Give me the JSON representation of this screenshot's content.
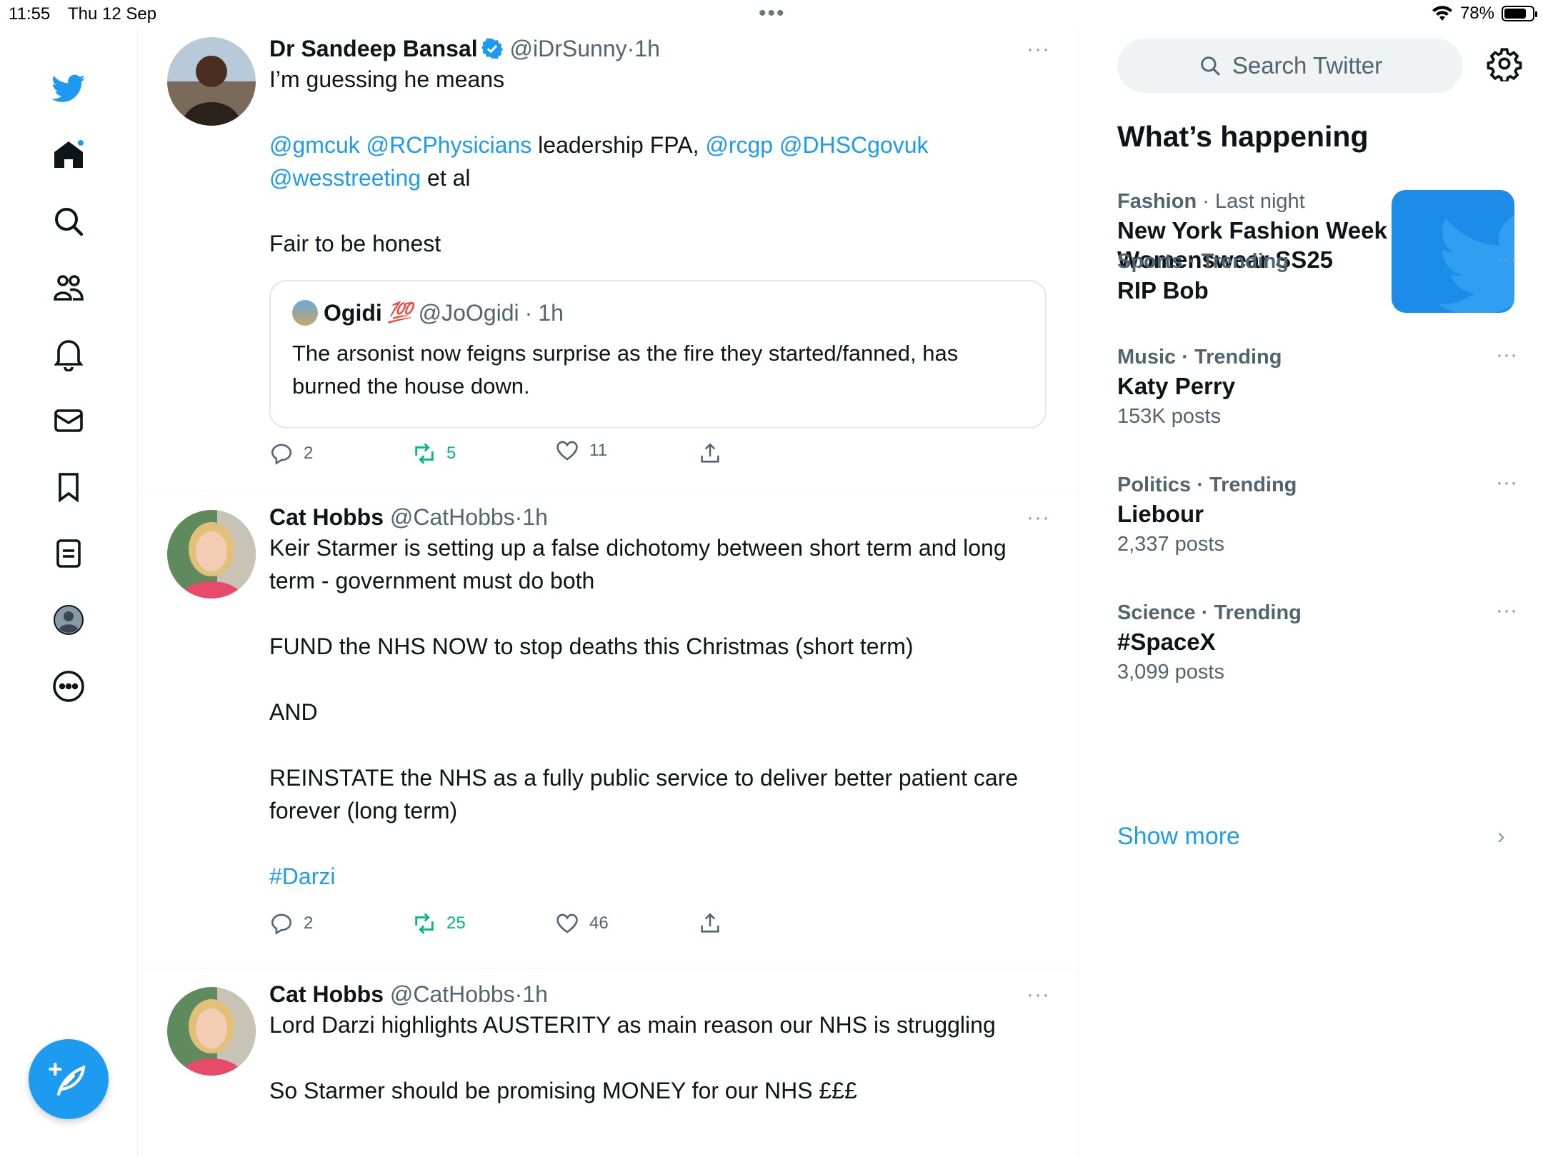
{
  "status": {
    "time": "11:55",
    "date": "Thu 12 Sep",
    "multitask": "•••",
    "battery": "78%",
    "battery_level": 0.78
  },
  "nav": {
    "items": [
      "twitter-logo",
      "home",
      "explore",
      "communities",
      "notifications",
      "messages",
      "bookmarks",
      "lists",
      "profile",
      "more"
    ],
    "home_has_new": true
  },
  "tweets": [
    {
      "name": "Dr Sandeep Bansal",
      "verified": true,
      "handle": "@iDrSunny",
      "sep": "·",
      "time": "1h",
      "more": "···",
      "lines": {
        "l1": "I’m guessing he means",
        "m1": "@gmcuk",
        "m2": "@RCPhysicians",
        "t2": "leadership FPA,",
        "m3": "@rcgp",
        "m4": "@DHSCgovuk",
        "m5": "@wesstreeting",
        "t3": "et al",
        "l4": "Fair to be honest"
      },
      "quote": {
        "name": "Ogidi",
        "emoji": "💯",
        "handle": "@JoOgidi",
        "sep": "·",
        "time": "1h",
        "text": "The arsonist now feigns surprise as the fire they started/fanned, has burned the house down."
      },
      "stats": {
        "replies": "2",
        "retweets": "5",
        "likes": "11"
      }
    },
    {
      "name": "Cat Hobbs",
      "handle": "@CatHobbs",
      "sep": "·",
      "time": "1h",
      "more": "···",
      "lines": {
        "l1": "Keir Starmer is setting up a false dichotomy between short term and long term - government must do both",
        "l2": "FUND the NHS NOW to stop deaths this Christmas (short term)",
        "l3": "AND",
        "l4": "REINSTATE the NHS as a fully public service to deliver better patient care forever (long term)",
        "hashtag": "#Darzi"
      },
      "stats": {
        "replies": "2",
        "retweets": "25",
        "likes": "46"
      }
    },
    {
      "name": "Cat Hobbs",
      "handle": "@CatHobbs",
      "sep": "·",
      "time": "1h",
      "more": "···",
      "lines": {
        "l1": "Lord Darzi highlights AUSTERITY as main reason our NHS is struggling",
        "l2": "So Starmer should be promising MONEY for our NHS £££"
      }
    }
  ],
  "sidebar": {
    "search_placeholder": "Search Twitter",
    "title": "What’s happening",
    "trends": [
      {
        "category": "Fashion",
        "sep": "·",
        "context": "Last night",
        "title": "New York Fashion Week Womenswear SS25",
        "count": ""
      },
      {
        "category": "Sports",
        "sep": "·",
        "context": "Trending",
        "title": "RIP Bob",
        "count": ""
      },
      {
        "category": "Music",
        "sep": "·",
        "context": "Trending",
        "title": "Katy Perry",
        "count": "153K posts"
      },
      {
        "category": "Politics",
        "sep": "·",
        "context": "Trending",
        "title": "Liebour",
        "count": "2,337 posts"
      },
      {
        "category": "Science",
        "sep": "·",
        "context": "Trending",
        "title": "#SpaceX",
        "count": "3,099 posts"
      }
    ],
    "trend_more": "···",
    "show_more": "Show more",
    "chevron": "›"
  },
  "colors": {
    "accent": "#1d9bf0",
    "retweet": "#00ba7c",
    "muted": "#536471"
  }
}
